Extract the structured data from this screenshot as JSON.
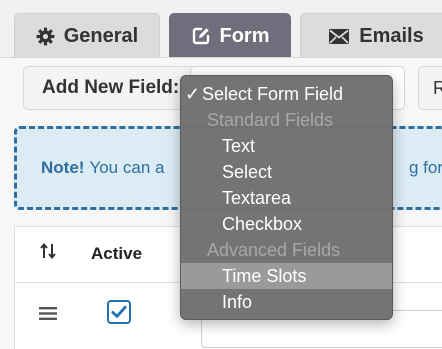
{
  "tabs": [
    {
      "label": "General",
      "icon": "gear-icon",
      "active": false
    },
    {
      "label": "Form",
      "icon": "edit-icon",
      "active": true
    },
    {
      "label": "Emails",
      "icon": "envelope-icon",
      "active": false
    }
  ],
  "toolbar": {
    "add_field_label": "Add New Field:",
    "reset_label": "R"
  },
  "note": {
    "bold": "Note!",
    "text": "You can a",
    "tail": "g form"
  },
  "table": {
    "columns": {
      "active": "Active"
    },
    "rows": [
      {
        "active": true
      }
    ]
  },
  "dropdown": {
    "selected_label": "Select Form Field",
    "options": [
      {
        "label": "Standard Fields",
        "kind": "group"
      },
      {
        "label": "Text",
        "kind": "item"
      },
      {
        "label": "Select",
        "kind": "item"
      },
      {
        "label": "Textarea",
        "kind": "item"
      },
      {
        "label": "Checkbox",
        "kind": "item"
      },
      {
        "label": "Advanced Fields",
        "kind": "group"
      },
      {
        "label": "Time Slots",
        "kind": "item",
        "highlighted": true
      },
      {
        "label": "Info",
        "kind": "item"
      }
    ]
  },
  "colors": {
    "active_tab": "#6e6e7c",
    "note_border": "#2f6e9e",
    "note_bg": "#dcecf5",
    "checkbox": "#2271b1",
    "dropdown_bg": "#707070"
  }
}
